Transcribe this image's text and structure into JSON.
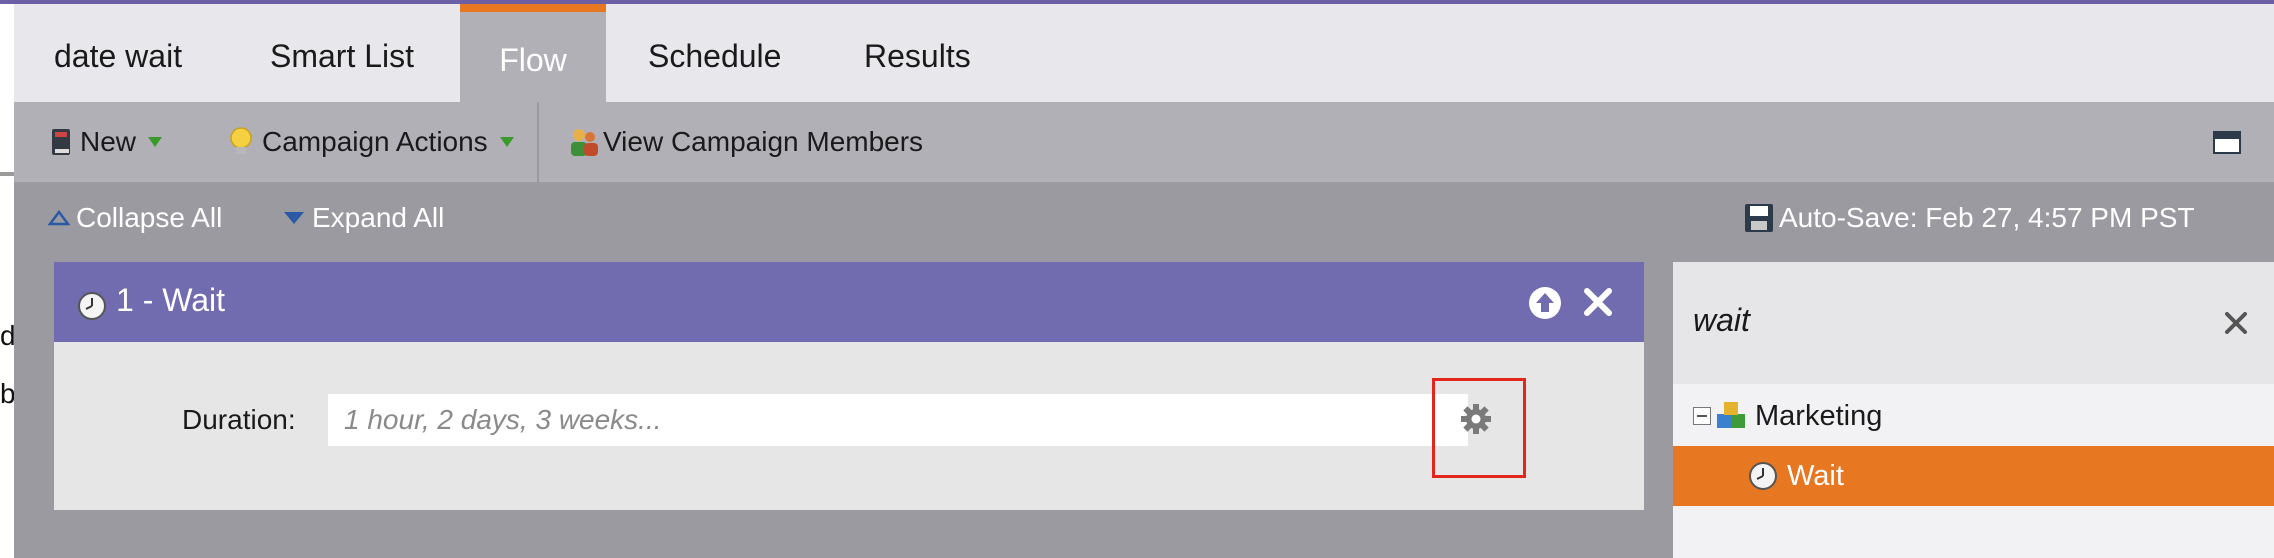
{
  "tabs": [
    {
      "label": "date wait",
      "active": false
    },
    {
      "label": "Smart List",
      "active": false
    },
    {
      "label": "Flow",
      "active": true
    },
    {
      "label": "Schedule",
      "active": false
    },
    {
      "label": "Results",
      "active": false
    }
  ],
  "toolbar": {
    "new_label": "New",
    "campaign_actions_label": "Campaign Actions",
    "view_members_label": "View Campaign Members"
  },
  "canvas": {
    "collapse_all": "Collapse All",
    "expand_all": "Expand All",
    "autosave": "Auto-Save: Feb 27, 4:57 PM PST"
  },
  "flow_step": {
    "title": "1 - Wait",
    "duration_label": "Duration:",
    "duration_value": "",
    "duration_placeholder": "1 hour, 2 days, 3 weeks..."
  },
  "palette": {
    "search_value": "wait",
    "category": "Marketing",
    "item": "Wait"
  },
  "gutter_text": [
    "d",
    "b"
  ],
  "colors": {
    "accent_orange": "#e87722",
    "step_header": "#716cb0",
    "toolbar_bg": "#b1b0b6",
    "canvas_bg": "#9b9aa0",
    "highlight_red": "#e2261b"
  },
  "icons": {
    "new": "book-icon",
    "campaign_actions": "lightbulb-icon",
    "view_members": "people-icon",
    "window": "window-icon",
    "collapse": "triangle-up-icon",
    "expand": "triangle-down-icon",
    "autosave": "floppy-icon",
    "step": "clock-icon",
    "move_up": "arrow-up-circle-icon",
    "delete": "close-icon",
    "settings": "gear-icon",
    "category": "marketing-blocks-icon"
  }
}
